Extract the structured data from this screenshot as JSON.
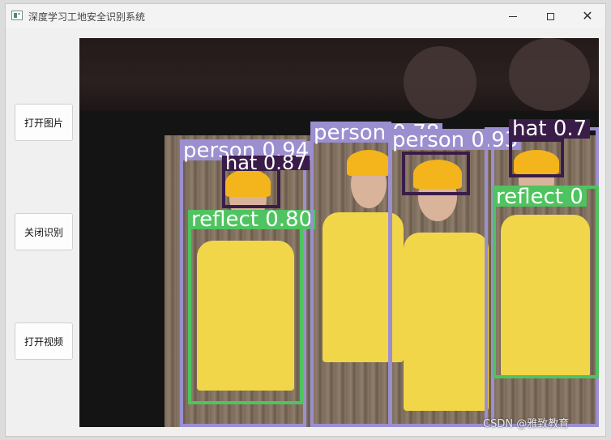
{
  "window": {
    "title": "深度学习工地安全识别系统"
  },
  "controls": {
    "minimize": "minimize",
    "maximize": "maximize",
    "close": "✕"
  },
  "sidebar": {
    "buttons": [
      {
        "label": "打开图片"
      },
      {
        "label": "关闭识别"
      },
      {
        "label": "打开视频"
      }
    ]
  },
  "detections": [
    {
      "label": "person 0.94"
    },
    {
      "label": "hat 0.87"
    },
    {
      "label": "reflect 0.80"
    },
    {
      "label": "person 0.78"
    },
    {
      "label": "person 0.93"
    },
    {
      "label": "hat 0.7"
    },
    {
      "label": "reflect 0"
    }
  ],
  "watermark": "CSDN @雅致教育",
  "colors": {
    "person": "#9b8fd0",
    "reflect": "#4fc35f",
    "hat": "#3a1c49"
  }
}
